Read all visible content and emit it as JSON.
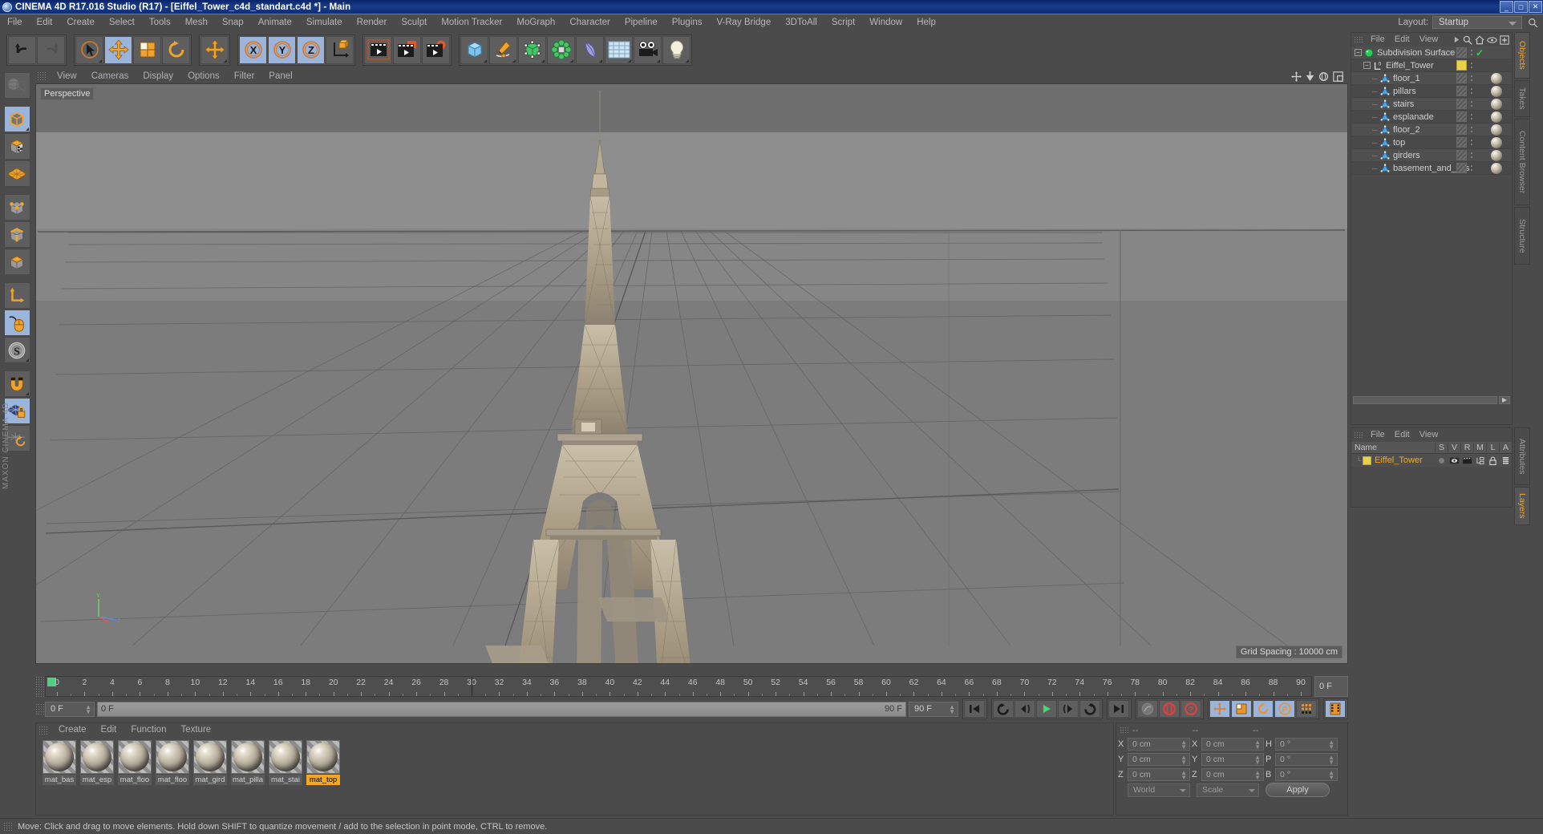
{
  "window": {
    "title": "CINEMA 4D R17.016 Studio (R17) - [Eiffel_Tower_c4d_standart.c4d *] - Main",
    "buttons": {
      "minimize": "_",
      "maximize": "□",
      "close": "✕"
    }
  },
  "menubar": {
    "items": [
      "File",
      "Edit",
      "Create",
      "Select",
      "Tools",
      "Mesh",
      "Snap",
      "Animate",
      "Simulate",
      "Render",
      "Sculpt",
      "Motion Tracker",
      "MoGraph",
      "Character",
      "Pipeline",
      "Plugins",
      "V-Ray Bridge",
      "3DToAll",
      "Script",
      "Window",
      "Help"
    ],
    "layout_label": "Layout:",
    "layout_value": "Startup"
  },
  "toolbar": {
    "groups": [
      {
        "name": "undo-redo",
        "buttons": [
          {
            "name": "undo-button",
            "icon": "undo-icon",
            "active": false
          },
          {
            "name": "redo-button",
            "icon": "redo-icon",
            "active": false,
            "disabled": true
          }
        ]
      },
      {
        "name": "transform-tools",
        "buttons": [
          {
            "name": "live-selection-button",
            "icon": "cursor-select-icon",
            "active": false
          },
          {
            "name": "move-button",
            "icon": "move-icon",
            "active": true
          },
          {
            "name": "scale-button",
            "icon": "scale-icon",
            "active": false
          },
          {
            "name": "rotate-button",
            "icon": "rotate-icon",
            "active": false
          }
        ]
      },
      {
        "name": "move-extra",
        "buttons": [
          {
            "name": "move-alt-button",
            "icon": "move-icon",
            "active": false
          }
        ]
      },
      {
        "name": "axis-locks",
        "buttons": [
          {
            "name": "lock-x-button",
            "icon": "axis-x-icon",
            "active": true
          },
          {
            "name": "lock-y-button",
            "icon": "axis-y-icon",
            "active": true
          },
          {
            "name": "lock-z-button",
            "icon": "axis-z-icon",
            "active": true
          },
          {
            "name": "world-object-coord-button",
            "icon": "world-axis-icon",
            "active": false
          }
        ]
      },
      {
        "name": "render-tools",
        "buttons": [
          {
            "name": "render-view-button",
            "icon": "render-view-icon",
            "active": false
          },
          {
            "name": "render-region-button",
            "icon": "render-region-icon",
            "active": false
          },
          {
            "name": "render-settings-button",
            "icon": "render-settings-icon",
            "active": false
          }
        ]
      },
      {
        "name": "create-objects",
        "buttons": [
          {
            "name": "add-cube-button",
            "icon": "cube-icon",
            "active": false
          },
          {
            "name": "add-spline-button",
            "icon": "pen-spline-icon",
            "active": false
          },
          {
            "name": "add-generator-button",
            "icon": "generator-icon",
            "active": false
          },
          {
            "name": "add-array-button",
            "icon": "array-icon",
            "active": false
          },
          {
            "name": "add-deformer-button",
            "icon": "deformer-icon",
            "active": false
          },
          {
            "name": "add-scene-button",
            "icon": "floor-scene-icon",
            "active": false
          },
          {
            "name": "add-camera-button",
            "icon": "camera-icon",
            "active": false
          },
          {
            "name": "add-light-button",
            "icon": "light-bulb-icon",
            "active": false
          }
        ]
      }
    ]
  },
  "left_toolbar": {
    "buttons": [
      {
        "name": "make-editable-button",
        "icon": "make-editable-icon",
        "active": false
      },
      {
        "name": "model-mode-button",
        "icon": "model-mode-icon",
        "active": true
      },
      {
        "name": "texture-mode-button",
        "icon": "texture-mode-icon",
        "active": false
      },
      {
        "name": "workplane-mode-button",
        "icon": "workplane-icon",
        "active": false
      },
      {
        "name": "points-mode-button",
        "icon": "points-mode-icon",
        "active": false
      },
      {
        "name": "edges-mode-button",
        "icon": "edges-mode-icon",
        "active": false
      },
      {
        "name": "polygons-mode-button",
        "icon": "polygons-mode-icon",
        "active": false
      },
      {
        "name": "object-axis-button",
        "icon": "axis-l-icon",
        "active": false
      },
      {
        "name": "viewport-solo-button",
        "icon": "mouse-icon",
        "active": true
      },
      {
        "name": "soft-selection-button",
        "icon": "s-compass-icon",
        "active": false
      },
      {
        "name": "enable-snap-button",
        "icon": "magnet-icon",
        "active": false
      },
      {
        "name": "lock-workplane-button",
        "icon": "workplane-lock-icon",
        "active": true
      },
      {
        "name": "planar-workplane-button",
        "icon": "workplane-rotate-icon",
        "active": false
      }
    ],
    "brand": "MAXON CINEMA 4D"
  },
  "viewport": {
    "menu": [
      "View",
      "Cameras",
      "Display",
      "Options",
      "Filter",
      "Panel"
    ],
    "label": "Perspective",
    "grid_spacing": "Grid Spacing : 10000 cm",
    "nav_icons": [
      "pan-icon",
      "dolly-icon",
      "orbit-icon",
      "maximize-viewport-icon"
    ],
    "axis_labels": {
      "y": "Y",
      "x": "X",
      "z": "Z"
    },
    "scene_subject": "Eiffel Tower model"
  },
  "timeline": {
    "start_frame": "0 F",
    "end_frame": "90 F",
    "current_frame_field": "0 F",
    "preview_min": "0 F",
    "preview_max": "90 F",
    "right_frame_field": "0 F",
    "ticks": [
      0,
      2,
      4,
      6,
      8,
      10,
      12,
      14,
      16,
      18,
      20,
      22,
      24,
      26,
      28,
      30,
      32,
      34,
      36,
      38,
      40,
      42,
      44,
      46,
      48,
      50,
      52,
      54,
      56,
      58,
      60,
      62,
      64,
      66,
      68,
      70,
      72,
      74,
      76,
      78,
      80,
      82,
      84,
      86,
      88,
      90
    ],
    "transport_buttons": [
      {
        "name": "go-to-start-button",
        "icon": "skip-start-icon"
      },
      {
        "name": "previous-keyframe-button",
        "icon": "prev-key-icon"
      },
      {
        "name": "step-back-button",
        "icon": "step-back-icon"
      },
      {
        "name": "play-button",
        "icon": "play-icon"
      },
      {
        "name": "step-forward-button",
        "icon": "step-forward-icon"
      },
      {
        "name": "next-keyframe-button",
        "icon": "next-key-icon"
      },
      {
        "name": "go-to-end-button",
        "icon": "skip-end-icon"
      }
    ],
    "record_buttons": [
      {
        "name": "autokeying-button",
        "icon": "autokey-icon"
      },
      {
        "name": "record-active-objects-button",
        "icon": "record-icon"
      },
      {
        "name": "key-selection-button",
        "icon": "key-question-icon"
      }
    ],
    "key_toggle_buttons": [
      {
        "name": "record-position-button",
        "icon": "position-key-icon"
      },
      {
        "name": "record-scale-button",
        "icon": "scale-key-icon"
      },
      {
        "name": "record-rotation-button",
        "icon": "rotation-key-icon"
      },
      {
        "name": "record-parameter-button",
        "icon": "parameter-key-icon"
      },
      {
        "name": "record-pla-button",
        "icon": "pla-key-icon"
      }
    ],
    "extra_button": {
      "name": "timeline-toggle-button",
      "icon": "film-strip-icon"
    }
  },
  "material_manager": {
    "menu": [
      "Create",
      "Edit",
      "Function",
      "Texture"
    ],
    "materials": [
      {
        "name": "mat_bas",
        "selected": false
      },
      {
        "name": "mat_esp",
        "selected": false
      },
      {
        "name": "mat_floo",
        "selected": false
      },
      {
        "name": "mat_floo",
        "selected": false
      },
      {
        "name": "mat_gird",
        "selected": false
      },
      {
        "name": "mat_pilla",
        "selected": false
      },
      {
        "name": "mat_stai",
        "selected": false
      },
      {
        "name": "mat_top",
        "selected": true
      }
    ]
  },
  "coordinates": {
    "header": [
      "--",
      "--",
      "--"
    ],
    "rows": [
      {
        "pos_label": "X",
        "pos_value": "0 cm",
        "size_label": "X",
        "size_value": "0 cm",
        "rot_label": "H",
        "rot_value": "0 °"
      },
      {
        "pos_label": "Y",
        "pos_value": "0 cm",
        "size_label": "Y",
        "size_value": "0 cm",
        "rot_label": "P",
        "rot_value": "0 °"
      },
      {
        "pos_label": "Z",
        "pos_value": "0 cm",
        "size_label": "Z",
        "size_value": "0 cm",
        "rot_label": "B",
        "rot_value": "0 °"
      }
    ],
    "system_select": "World",
    "mode_select": "Scale",
    "apply_label": "Apply"
  },
  "object_manager": {
    "menu": [
      "File",
      "Edit",
      "View"
    ],
    "icons": [
      "search-icon",
      "home-icon",
      "eye-icon",
      "add-layer-icon"
    ],
    "objects": [
      {
        "name": "Subdivision Surface",
        "icon": "subdivision-surface-icon",
        "depth": 0,
        "selected": false,
        "visibility_box": "hatched",
        "has_check": true,
        "material": false
      },
      {
        "name": "Eiffel_Tower",
        "icon": "null-object-icon",
        "depth": 1,
        "selected": false,
        "visibility_box": "yellow",
        "has_check": false,
        "material": false
      },
      {
        "name": "floor_1",
        "icon": "polygon-object-icon",
        "depth": 2,
        "selected": false,
        "visibility_box": "hatched",
        "has_check": false,
        "material": true
      },
      {
        "name": "pillars",
        "icon": "polygon-object-icon",
        "depth": 2,
        "selected": false,
        "visibility_box": "hatched",
        "has_check": false,
        "material": true
      },
      {
        "name": "stairs",
        "icon": "polygon-object-icon",
        "depth": 2,
        "selected": false,
        "visibility_box": "hatched",
        "has_check": false,
        "material": true
      },
      {
        "name": "esplanade",
        "icon": "polygon-object-icon",
        "depth": 2,
        "selected": false,
        "visibility_box": "hatched",
        "has_check": false,
        "material": true
      },
      {
        "name": "floor_2",
        "icon": "polygon-object-icon",
        "depth": 2,
        "selected": false,
        "visibility_box": "hatched",
        "has_check": false,
        "material": true
      },
      {
        "name": "top",
        "icon": "polygon-object-icon",
        "depth": 2,
        "selected": false,
        "visibility_box": "hatched",
        "has_check": false,
        "material": true
      },
      {
        "name": "girders",
        "icon": "polygon-object-icon",
        "depth": 2,
        "selected": false,
        "visibility_box": "hatched",
        "has_check": false,
        "material": true
      },
      {
        "name": "basement_and_lifts",
        "icon": "polygon-object-icon",
        "depth": 2,
        "selected": false,
        "visibility_box": "hatched",
        "has_check": false,
        "material": true
      }
    ]
  },
  "layer_manager": {
    "menu": [
      "File",
      "Edit",
      "View"
    ],
    "columns": [
      "Name",
      "S",
      "V",
      "R",
      "M",
      "L",
      "A"
    ],
    "rows": [
      {
        "name": "Eiffel_Tower",
        "color": "#e8d24a"
      }
    ]
  },
  "right_tabs": {
    "upper": [
      "Objects",
      "Takes",
      "Content Browser",
      "Structure"
    ],
    "upper_active": "Objects",
    "lower": [
      "Attributes",
      "Layers"
    ],
    "lower_active": "Layers"
  },
  "status_bar": {
    "text": "Move: Click and drag to move elements. Hold down SHIFT to quantize movement / add to the selection in point mode, CTRL to remove."
  },
  "colors": {
    "accent": "#f5a623",
    "title_blue": "#0a246a",
    "panel_bg": "#4b4b4b",
    "button_bg": "#5e5e5e",
    "active_blue": "#9ab4dc",
    "green_check": "#3ecf5c"
  }
}
